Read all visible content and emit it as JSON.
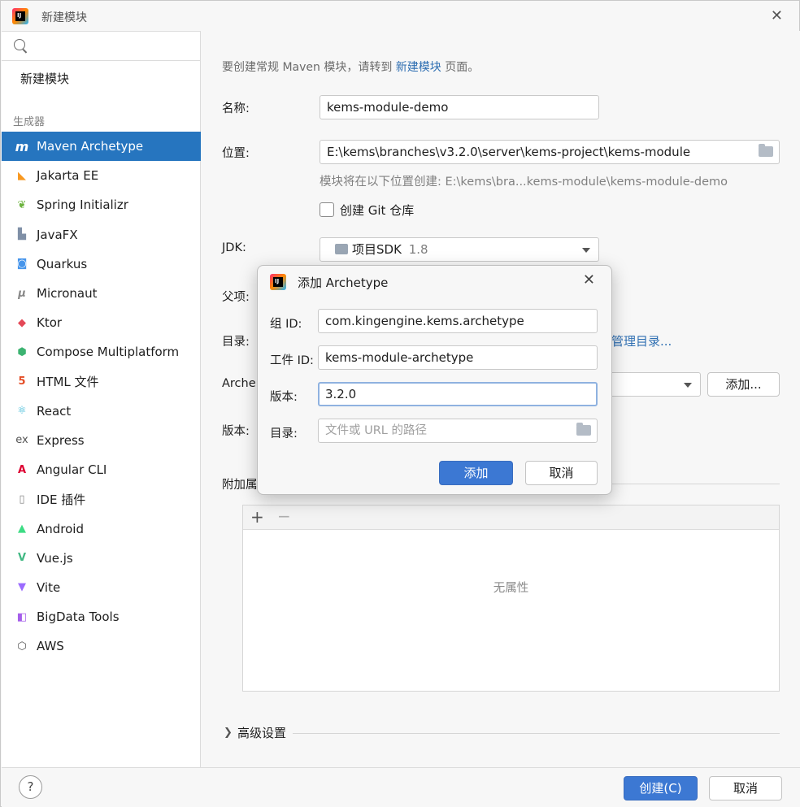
{
  "window": {
    "title": "新建模块"
  },
  "sidebar": {
    "search_placeholder": "",
    "new_module": "新建模块",
    "generators_label": "生成器",
    "items": [
      {
        "label": "Maven Archetype",
        "icon": "maven-icon"
      },
      {
        "label": "Jakarta EE",
        "icon": "jakarta-icon"
      },
      {
        "label": "Spring Initializr",
        "icon": "spring-icon"
      },
      {
        "label": "JavaFX",
        "icon": "javafx-icon"
      },
      {
        "label": "Quarkus",
        "icon": "quarkus-icon"
      },
      {
        "label": "Micronaut",
        "icon": "micronaut-icon"
      },
      {
        "label": "Ktor",
        "icon": "ktor-icon"
      },
      {
        "label": "Compose Multiplatform",
        "icon": "compose-icon"
      },
      {
        "label": "HTML 文件",
        "icon": "html5-icon"
      },
      {
        "label": "React",
        "icon": "react-icon"
      },
      {
        "label": "Express",
        "icon": "express-icon"
      },
      {
        "label": "Angular CLI",
        "icon": "angular-icon"
      },
      {
        "label": "IDE 插件",
        "icon": "ide-plugin-icon"
      },
      {
        "label": "Android",
        "icon": "android-icon"
      },
      {
        "label": "Vue.js",
        "icon": "vue-icon"
      },
      {
        "label": "Vite",
        "icon": "vite-icon"
      },
      {
        "label": "BigData Tools",
        "icon": "bigdata-icon"
      },
      {
        "label": "AWS",
        "icon": "aws-icon"
      }
    ]
  },
  "main": {
    "info_prefix": "要创建常规 Maven 模块，请转到",
    "info_link": "新建模块",
    "info_suffix": "页面。",
    "name_label": "名称:",
    "name_value": "kems-module-demo",
    "location_label": "位置:",
    "location_value": "E:\\kems\\branches\\v3.2.0\\server\\kems-project\\kems-module",
    "location_hint": "模块将在以下位置创建: E:\\kems\\bra...kems-module\\kems-module-demo",
    "git_label": "创建 Git 仓库",
    "jdk_label": "JDK:",
    "jdk_value": "项目SDK",
    "jdk_version": "1.8",
    "parent_label": "父项:",
    "catalog_label": "目录:",
    "catalog_link": "管理目录...",
    "archetype_label": "Arche",
    "archetype_add_button": "添加...",
    "version_label": "版本:",
    "props_label": "附加属",
    "props_empty": "无属性",
    "advanced_label": "高级设置"
  },
  "footer": {
    "help": "?",
    "create_button": "创建(C)",
    "cancel_button": "取消"
  },
  "dialog": {
    "title": "添加 Archetype",
    "group_label": "组 ID:",
    "group_value": "com.kingengine.kems.archetype",
    "artifact_label": "工件 ID:",
    "artifact_value": "kems-module-archetype",
    "version_label": "版本:",
    "version_value": "3.2.0",
    "catalog_label": "目录:",
    "catalog_placeholder": "文件或 URL 的路径",
    "add_button": "添加",
    "cancel_button": "取消"
  }
}
